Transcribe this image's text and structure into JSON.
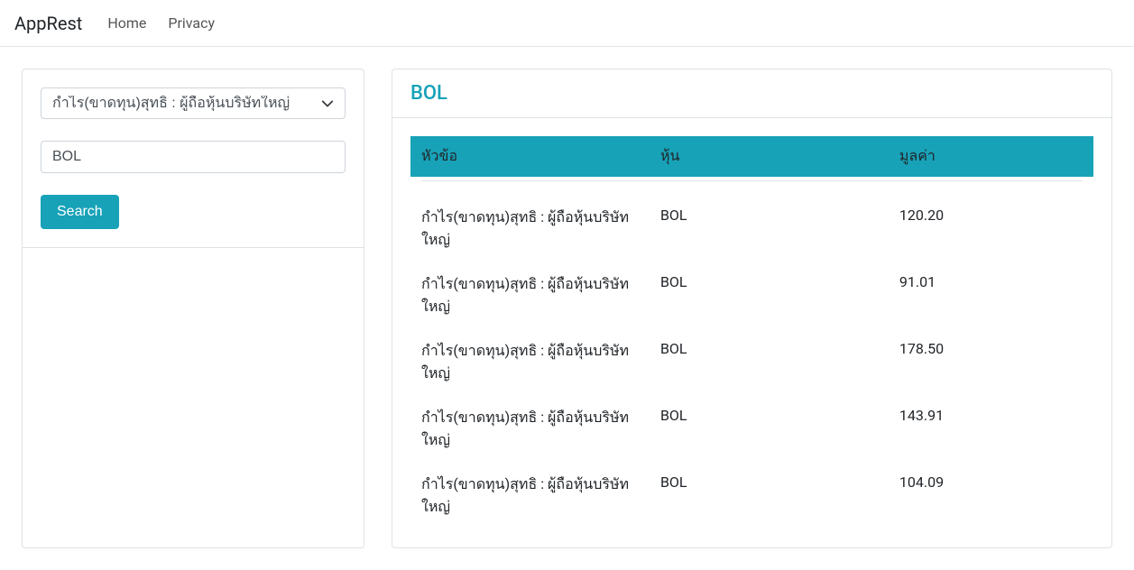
{
  "navbar": {
    "brand": "AppRest",
    "links": [
      {
        "label": "Home"
      },
      {
        "label": "Privacy"
      }
    ]
  },
  "search": {
    "select_value": "กำไร(ขาดทุน)สุทธิ : ผู้ถือหุ้นบริษัทใหญ่",
    "input_value": "BOL",
    "button_label": "Search"
  },
  "result": {
    "title": "BOL",
    "columns": {
      "topic": "หัวข้อ",
      "stock": "หุ้น",
      "value": "มูลค่า"
    },
    "rows": [
      {
        "topic": "กำไร(ขาดทุน)สุทธิ : ผู้ถือหุ้นบริษัทใหญ่",
        "stock": "BOL",
        "value": "120.20"
      },
      {
        "topic": "กำไร(ขาดทุน)สุทธิ : ผู้ถือหุ้นบริษัทใหญ่",
        "stock": "BOL",
        "value": "91.01"
      },
      {
        "topic": "กำไร(ขาดทุน)สุทธิ : ผู้ถือหุ้นบริษัทใหญ่",
        "stock": "BOL",
        "value": "178.50"
      },
      {
        "topic": "กำไร(ขาดทุน)สุทธิ : ผู้ถือหุ้นบริษัทใหญ่",
        "stock": "BOL",
        "value": "143.91"
      },
      {
        "topic": "กำไร(ขาดทุน)สุทธิ : ผู้ถือหุ้นบริษัทใหญ่",
        "stock": "BOL",
        "value": "104.09"
      }
    ]
  }
}
